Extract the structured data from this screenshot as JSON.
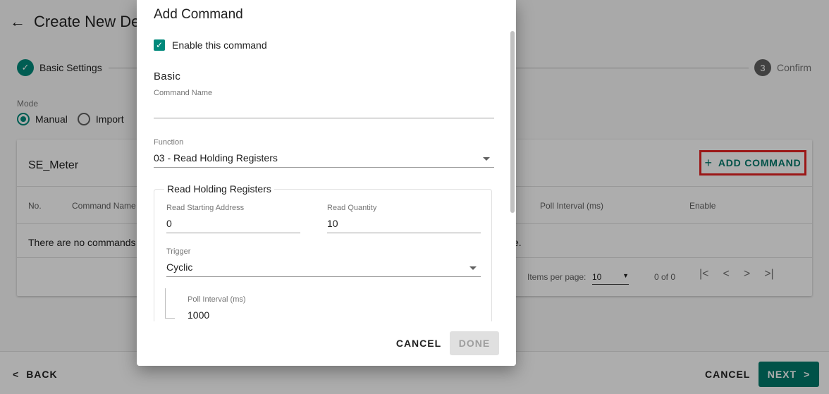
{
  "page": {
    "title": "Create New De",
    "stepper": {
      "step1": {
        "number": "✓",
        "label": "Basic Settings"
      },
      "step3": {
        "number": "3",
        "label": "Confirm"
      }
    },
    "mode": {
      "label": "Mode",
      "options": [
        {
          "label": "Manual",
          "selected": true
        },
        {
          "label": "Import",
          "selected": false
        }
      ]
    },
    "card": {
      "title": "SE_Meter",
      "add_command_label": "ADD COMMAND",
      "columns": [
        "No.",
        "Command Name",
        "Poll Interval (ms)",
        "Enable"
      ],
      "empty_text": "There are no commands",
      "empty_tail": "e.",
      "paginator": {
        "items_per_page_label": "Items per page:",
        "items_per_page": "10",
        "range": "0 of 0"
      }
    },
    "footer": {
      "back_label": "BACK",
      "cancel_label": "CANCEL",
      "next_label": "NEXT"
    }
  },
  "dialog": {
    "title": "Add Command",
    "enable_label": "Enable this command",
    "enable_checked": true,
    "basic_heading": "Basic",
    "command_name": {
      "label": "Command Name",
      "value": ""
    },
    "function": {
      "label": "Function",
      "value": "03 - Read Holding Registers"
    },
    "group_title": "Read Holding Registers",
    "read_starting_address": {
      "label": "Read Starting Address",
      "value": "0"
    },
    "read_quantity": {
      "label": "Read Quantity",
      "value": "10"
    },
    "trigger": {
      "label": "Trigger",
      "value": "Cyclic"
    },
    "poll_interval": {
      "label": "Poll Interval (ms)",
      "value": "1000"
    },
    "cancel_label": "CANCEL",
    "done_label": "DONE"
  },
  "colors": {
    "accent": "#00796b",
    "highlight_border": "#e52222",
    "scrim": "rgba(0,0,0,0.32)"
  }
}
